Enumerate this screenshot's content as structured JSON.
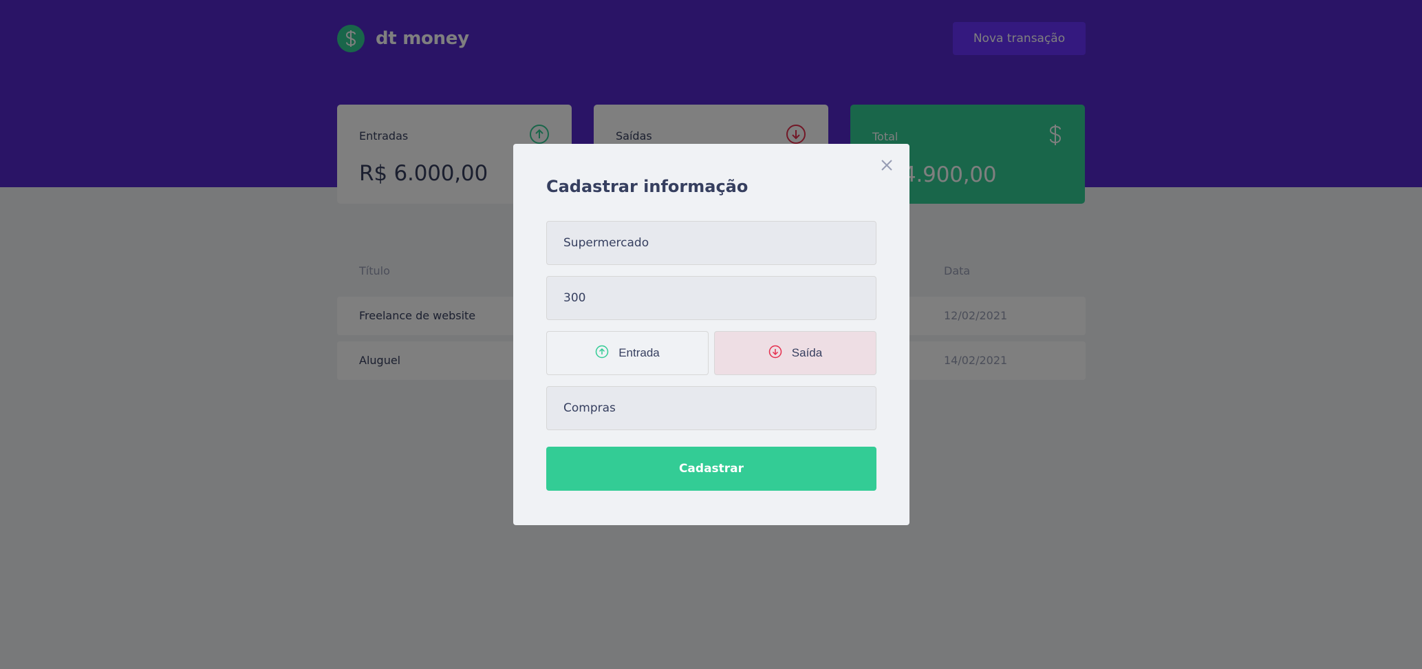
{
  "header": {
    "logo_text": "dt money",
    "new_transaction_label": "Nova transação"
  },
  "summary": {
    "income": {
      "label": "Entradas",
      "value": "R$ 6.000,00"
    },
    "outcome": {
      "label": "Saídas"
    },
    "total": {
      "label": "Total",
      "value": "4.900,00"
    }
  },
  "table": {
    "headers": {
      "title": "Título",
      "date": "Data"
    },
    "rows": [
      {
        "title": "Freelance de website",
        "date": "12/02/2021"
      },
      {
        "title": "Aluguel",
        "date": "14/02/2021"
      }
    ]
  },
  "modal": {
    "title": "Cadastrar informação",
    "title_field_value": "Supermercado",
    "amount_field_value": "300",
    "type_income_label": "Entrada",
    "type_outcome_label": "Saída",
    "category_field_value": "Compras",
    "submit_label": "Cadastrar"
  },
  "colors": {
    "brand": "#5429cc",
    "green": "#33cc95",
    "red": "#e52e4d",
    "text": "#363f5f"
  }
}
